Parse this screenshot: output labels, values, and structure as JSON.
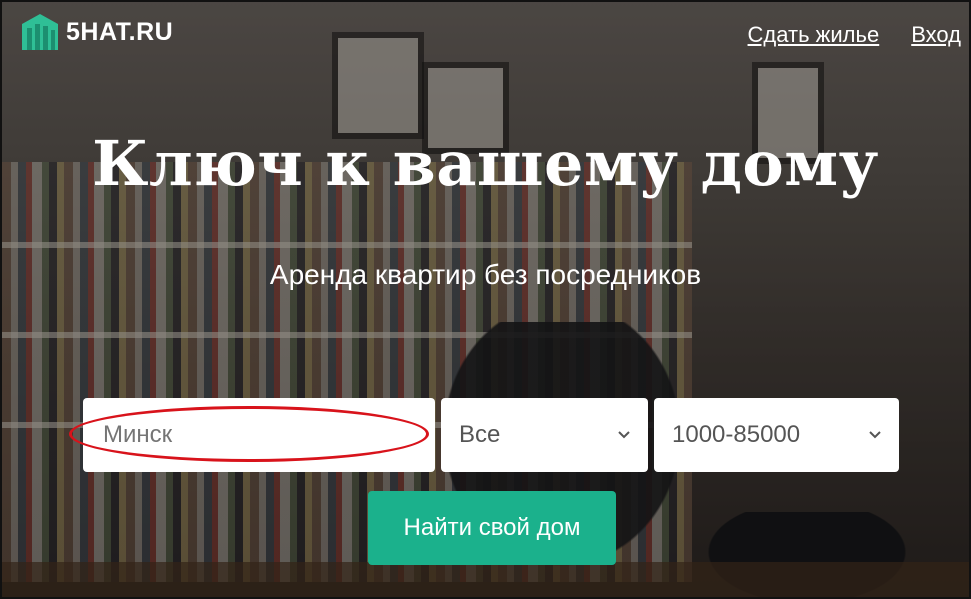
{
  "header": {
    "logo_text": "5HAT.RU",
    "logo_icon": "building-icon",
    "nav": [
      {
        "label": "Сдать жилье"
      },
      {
        "label": "Вход"
      }
    ]
  },
  "hero": {
    "title": "Ключ к вашему дому",
    "subtitle": "Аренда квартир без посредников"
  },
  "search": {
    "city_placeholder": "Минск",
    "type_selected": "Все",
    "price_selected": "1000-85000",
    "submit_label": "Найти свой дом"
  },
  "colors": {
    "accent": "#1bb18c",
    "highlight": "#d8131b"
  }
}
